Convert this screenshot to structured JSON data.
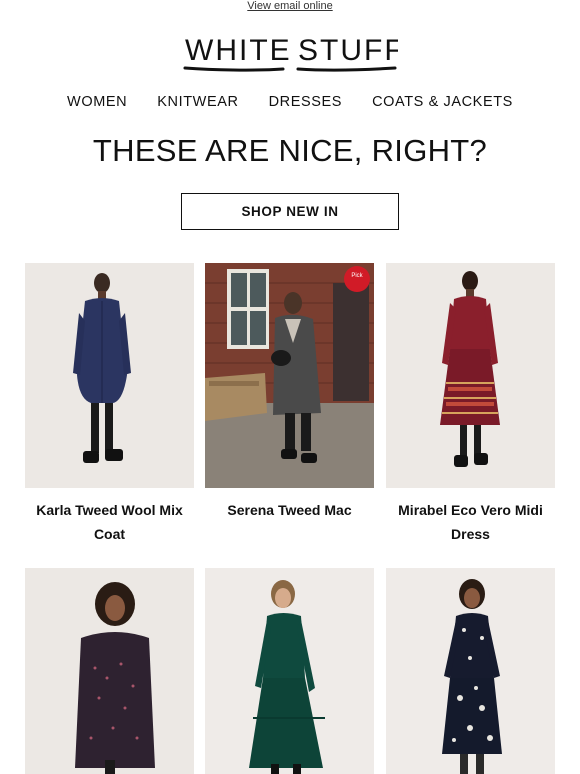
{
  "header": {
    "view_online": "View email online",
    "logo_word1": "WHITE",
    "logo_word2": "STUFF"
  },
  "nav": [
    {
      "label": "WOMEN"
    },
    {
      "label": "KNITWEAR"
    },
    {
      "label": "DRESSES"
    },
    {
      "label": "COATS & JACKETS"
    }
  ],
  "hero": {
    "headline": "THESE ARE NICE, RIGHT?",
    "cta_label": "SHOP NEW IN"
  },
  "products": [
    {
      "name": "Karla Tweed Wool Mix Coat",
      "image": "woman-navy-quilted-coat"
    },
    {
      "name": "Serena Tweed Mac",
      "image": "woman-grey-tweed-coat-street"
    },
    {
      "name": "Mirabel Eco Vero Midi Dress",
      "image": "woman-red-printed-midi-dress"
    },
    {
      "name": "",
      "image": "woman-dark-printed-tunic-dress"
    },
    {
      "name": "",
      "image": "woman-green-velvet-dress"
    },
    {
      "name": "",
      "image": "woman-navy-spot-dress"
    }
  ],
  "badge_text": "Pick"
}
